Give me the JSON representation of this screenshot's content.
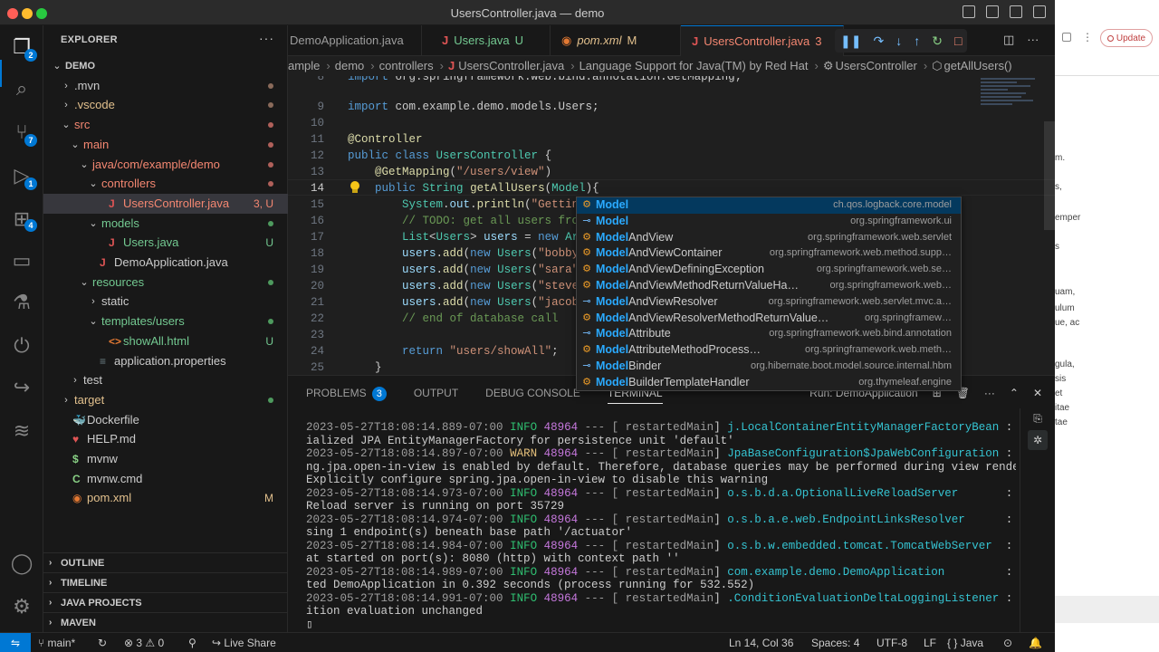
{
  "window": {
    "title": "UsersController.java — demo"
  },
  "background_app": {
    "update_label": "Update",
    "fragments": [
      "m.",
      "s,",
      "emper",
      "s",
      "uam,",
      "ulum",
      "ue, ac",
      "gula,",
      "sis",
      "et",
      "itae",
      "tae"
    ]
  },
  "activity": {
    "explorer_badge": "2",
    "scm_badge": "7",
    "debug_badge": "1",
    "extensions_badge": "4"
  },
  "sidebar": {
    "title": "EXPLORER",
    "more": "···",
    "items": [
      {
        "label": "DEMO",
        "level": 0,
        "chev": "v",
        "kind": "root"
      },
      {
        "label": ".mvn",
        "level": 1,
        "chev": ">",
        "kind": "folder",
        "dot": "#8a6a5a"
      },
      {
        "label": ".vscode",
        "level": 1,
        "chev": ">",
        "kind": "folder-olive",
        "dot": "#8a6a5a"
      },
      {
        "label": "src",
        "level": 1,
        "chev": "v",
        "kind": "folder-red",
        "dot": "#b0605a"
      },
      {
        "label": "main",
        "level": 2,
        "chev": "v",
        "kind": "folder-red",
        "dot": "#b0605a"
      },
      {
        "label": "java/com/example/demo",
        "level": 3,
        "chev": "v",
        "kind": "folder-red",
        "dot": "#b0605a"
      },
      {
        "label": "controllers",
        "level": 4,
        "chev": "v",
        "kind": "folder-red",
        "dot": "#b0605a"
      },
      {
        "label": "UsersController.java",
        "level": 5,
        "kind": "java-red",
        "badge": "3, U",
        "selected": true
      },
      {
        "label": "models",
        "level": 4,
        "chev": "v",
        "kind": "folder-green",
        "dot": "#4e9a5e"
      },
      {
        "label": "Users.java",
        "level": 5,
        "kind": "java-green",
        "badge": "U"
      },
      {
        "label": "DemoApplication.java",
        "level": 4,
        "kind": "java"
      },
      {
        "label": "resources",
        "level": 3,
        "chev": "v",
        "kind": "folder-green",
        "dot": "#4e9a5e"
      },
      {
        "label": "static",
        "level": 4,
        "chev": ">",
        "kind": "folder"
      },
      {
        "label": "templates/users",
        "level": 4,
        "chev": "v",
        "kind": "folder-green",
        "dot": "#4e9a5e"
      },
      {
        "label": "showAll.html",
        "level": 5,
        "kind": "html-green",
        "badge": "U"
      },
      {
        "label": "application.properties",
        "level": 4,
        "kind": "props"
      },
      {
        "label": "test",
        "level": 2,
        "chev": ">",
        "kind": "folder"
      },
      {
        "label": "target",
        "level": 1,
        "chev": ">",
        "kind": "folder-olive",
        "dot": "#4e9a5e"
      },
      {
        "label": "Dockerfile",
        "level": 1,
        "kind": "docker"
      },
      {
        "label": "HELP.md",
        "level": 1,
        "kind": "md"
      },
      {
        "label": "mvnw",
        "level": 1,
        "kind": "shell"
      },
      {
        "label": "mvnw.cmd",
        "level": 1,
        "kind": "cmd"
      },
      {
        "label": "pom.xml",
        "level": 1,
        "kind": "xml-olive",
        "badge": "M"
      }
    ],
    "sections": [
      "OUTLINE",
      "TIMELINE",
      "JAVA PROJECTS",
      "MAVEN"
    ]
  },
  "tabs": [
    {
      "label": "DemoApplication.java",
      "icon": "",
      "suffix": "",
      "active": false
    },
    {
      "label": "Users.java",
      "icon": "J",
      "suffix": "U",
      "active": false
    },
    {
      "label": "pom.xml",
      "icon": "rss",
      "suffix": "M",
      "active": false
    },
    {
      "label": "UsersController.java",
      "icon": "J",
      "suffix": "3",
      "active": true
    }
  ],
  "breadcrumb": [
    "ample",
    "demo",
    "controllers",
    "UsersController.java",
    "Language Support for Java(TM) by Red Hat",
    "UsersController",
    "getAllUsers()"
  ],
  "code": [
    {
      "n": "8",
      "html": "<span class='kw'>import</span> org.springframework.web.bind.annotation.GetMapping;"
    },
    {
      "n": "9",
      "html": "<span class='kw'>import</span> com.example.demo.models.Users;"
    },
    {
      "n": "10",
      "html": ""
    },
    {
      "n": "11",
      "html": "<span class='an'>@Controller</span>"
    },
    {
      "n": "12",
      "html": "<span class='kw'>public class</span> <span class='ty'>UsersController</span> {"
    },
    {
      "n": "13",
      "html": "    <span class='an'>@GetMapping</span>(<span class='st'>\"/users/view\"</span>)"
    },
    {
      "n": "14",
      "html": "    <span class='kw'>public</span> <span class='ty'>String</span> <span class='fn'>getAllUsers</span>(<span class='ty'>Model</span>){"
    },
    {
      "n": "15",
      "html": "        <span class='ty'>System</span>.<span class='va'>out</span>.<span class='fn'>println</span>(<span class='st'>\"Getting</span>"
    },
    {
      "n": "16",
      "html": "        <span class='cm'>// TODO: get all users from</span>"
    },
    {
      "n": "17",
      "html": "        <span class='ty'>List</span>&lt;<span class='ty'>Users</span>&gt; <span class='va'>users</span> = <span class='kw'>new</span> <span class='ty'>Arr</span>"
    },
    {
      "n": "18",
      "html": "        <span class='va'>users</span>.<span class='fn'>add</span>(<span class='kw'>new</span> <span class='ty'>Users</span>(<span class='st'>\"bobby\"</span>"
    },
    {
      "n": "19",
      "html": "        <span class='va'>users</span>.<span class='fn'>add</span>(<span class='kw'>new</span> <span class='ty'>Users</span>(<span class='st'>\"sara\"</span>,"
    },
    {
      "n": "20",
      "html": "        <span class='va'>users</span>.<span class='fn'>add</span>(<span class='kw'>new</span> <span class='ty'>Users</span>(<span class='st'>\"steve\"</span>"
    },
    {
      "n": "21",
      "html": "        <span class='va'>users</span>.<span class='fn'>add</span>(<span class='kw'>new</span> <span class='ty'>Users</span>(<span class='st'>\"jacob\"</span>"
    },
    {
      "n": "22",
      "html": "        <span class='cm'>// end of database call</span>"
    },
    {
      "n": "23",
      "html": ""
    },
    {
      "n": "24",
      "html": "        <span class='kw'>return</span> <span class='st'>\"users/showAll\"</span>;"
    },
    {
      "n": "25",
      "html": "    }"
    }
  ],
  "current_line": "14",
  "suggestions": [
    {
      "icon": "class",
      "match": "Model",
      "rest": "",
      "pkg": "ch.qos.logback.core.model",
      "selected": true
    },
    {
      "icon": "interface",
      "match": "Model",
      "rest": "",
      "pkg": "org.springframework.ui"
    },
    {
      "icon": "class",
      "match": "Model",
      "rest": "AndView",
      "pkg": "org.springframework.web.servlet"
    },
    {
      "icon": "class",
      "match": "Model",
      "rest": "AndViewContainer",
      "pkg": "org.springframework.web.method.supp…"
    },
    {
      "icon": "class",
      "match": "Model",
      "rest": "AndViewDefiningException",
      "pkg": "org.springframework.web.se…"
    },
    {
      "icon": "class",
      "match": "Model",
      "rest": "AndViewMethodReturnValueHa…",
      "pkg": "org.springframework.web…"
    },
    {
      "icon": "interface",
      "match": "Model",
      "rest": "AndViewResolver",
      "pkg": "org.springframework.web.servlet.mvc.a…"
    },
    {
      "icon": "class",
      "match": "Model",
      "rest": "AndViewResolverMethodReturnValue…",
      "pkg": "org.springframew…"
    },
    {
      "icon": "interface",
      "match": "Model",
      "rest": "Attribute",
      "pkg": "org.springframework.web.bind.annotation"
    },
    {
      "icon": "class",
      "match": "Model",
      "rest": "AttributeMethodProcess…",
      "pkg": "org.springframework.web.meth…"
    },
    {
      "icon": "interface",
      "match": "Model",
      "rest": "Binder",
      "pkg": "org.hibernate.boot.model.source.internal.hbm"
    },
    {
      "icon": "class",
      "match": "Model",
      "rest": "BuilderTemplateHandler",
      "pkg": "org.thymeleaf.engine"
    }
  ],
  "panel": {
    "tabs": [
      "PROBLEMS",
      "OUTPUT",
      "DEBUG CONSOLE",
      "TERMINAL"
    ],
    "problems_count": "3",
    "right_label": "Run: DemoApplication"
  },
  "terminal": [
    {
      "ts": "2023-05-27T18:08:14.889-07:00",
      "lvl": "INFO",
      "pid": "48964",
      "thr": "restartedMain",
      "cls": "j.LocalContainerEntityManagerFactoryBean",
      "msg": ": Init",
      "cont": "ialized JPA EntityManagerFactory for persistence unit 'default'"
    },
    {
      "ts": "2023-05-27T18:08:14.897-07:00",
      "lvl": "WARN",
      "pid": "48964",
      "thr": "restartedMain",
      "cls": "JpaBaseConfiguration$JpaWebConfiguration",
      "msg": ": spri",
      "cont": "ng.jpa.open-in-view is enabled by default. Therefore, database queries may be performed during view rendering.",
      "cont2": "Explicitly configure spring.jpa.open-in-view to disable this warning"
    },
    {
      "ts": "2023-05-27T18:08:14.973-07:00",
      "lvl": "INFO",
      "pid": "48964",
      "thr": "restartedMain",
      "cls": "o.s.b.d.a.OptionalLiveReloadServer",
      "msg": "      : Live",
      "cont": "Reload server is running on port 35729"
    },
    {
      "ts": "2023-05-27T18:08:14.974-07:00",
      "lvl": "INFO",
      "pid": "48964",
      "thr": "restartedMain",
      "cls": "o.s.b.a.e.web.EndpointLinksResolver",
      "msg": "     : Expo",
      "cont": "sing 1 endpoint(s) beneath base path '/actuator'"
    },
    {
      "ts": "2023-05-27T18:08:14.984-07:00",
      "lvl": "INFO",
      "pid": "48964",
      "thr": "restartedMain",
      "cls": "o.s.b.w.embedded.tomcat.TomcatWebServer",
      "msg": " : Tomc",
      "cont": "at started on port(s): 8080 (http) with context path ''"
    },
    {
      "ts": "2023-05-27T18:08:14.989-07:00",
      "lvl": "INFO",
      "pid": "48964",
      "thr": "restartedMain",
      "cls": "com.example.demo.DemoApplication",
      "msg": "        : Star",
      "cont": "ted DemoApplication in 0.392 seconds (process running for 532.552)"
    },
    {
      "ts": "2023-05-27T18:08:14.991-07:00",
      "lvl": "INFO",
      "pid": "48964",
      "thr": "restartedMain",
      "cls": ".ConditionEvaluationDeltaLoggingListener",
      "msg": ": Cond",
      "cont": "ition evaluation unchanged"
    }
  ],
  "statusbar": {
    "branch": "main*",
    "errors": "3",
    "warnings": "0",
    "live_share": "Live Share",
    "position": "Ln 14, Col 36",
    "spaces": "Spaces: 4",
    "encoding": "UTF-8",
    "eol": "LF",
    "language": "Java"
  },
  "colors": {
    "accent": "#0078d4",
    "editor_bg": "#1f1f1f",
    "sidebar_bg": "#181818"
  }
}
